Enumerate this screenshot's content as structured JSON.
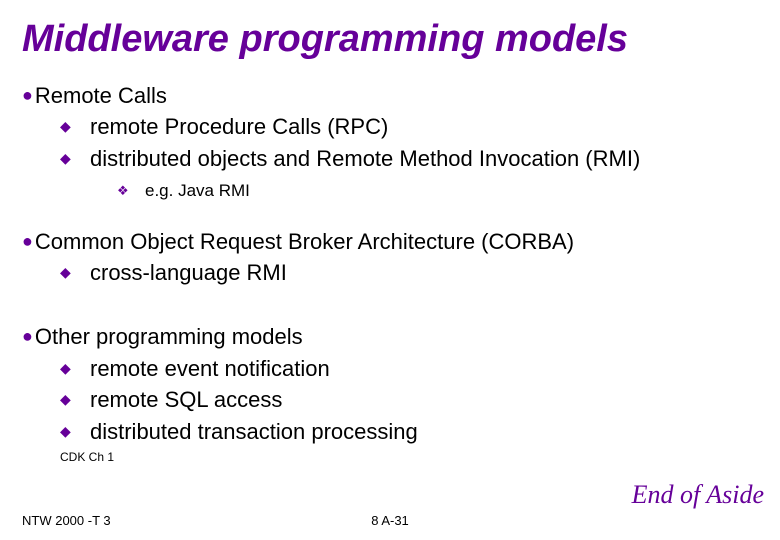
{
  "title": "Middleware programming models",
  "sections": [
    {
      "heading": "Remote Calls",
      "subs": [
        {
          "text": "remote Procedure Calls (RPC)"
        },
        {
          "text": "distributed objects and Remote Method Invocation (RMI)",
          "sub": "e.g. Java RMI"
        }
      ]
    },
    {
      "heading": "Common Object Request Broker Architecture (CORBA)",
      "subs": [
        {
          "text": "cross-language RMI"
        }
      ]
    },
    {
      "heading": "Other programming models",
      "subs": [
        {
          "text": "remote event notification"
        },
        {
          "text": "remote SQL access"
        },
        {
          "text": "distributed transaction processing"
        }
      ]
    }
  ],
  "reference": "CDK Ch 1",
  "footer_left": "NTW 2000 -T 3",
  "page_number": "8 A-31",
  "end_aside": "End of Aside",
  "bullets": {
    "l1": "●",
    "l2": "◆",
    "l3": "❖"
  }
}
